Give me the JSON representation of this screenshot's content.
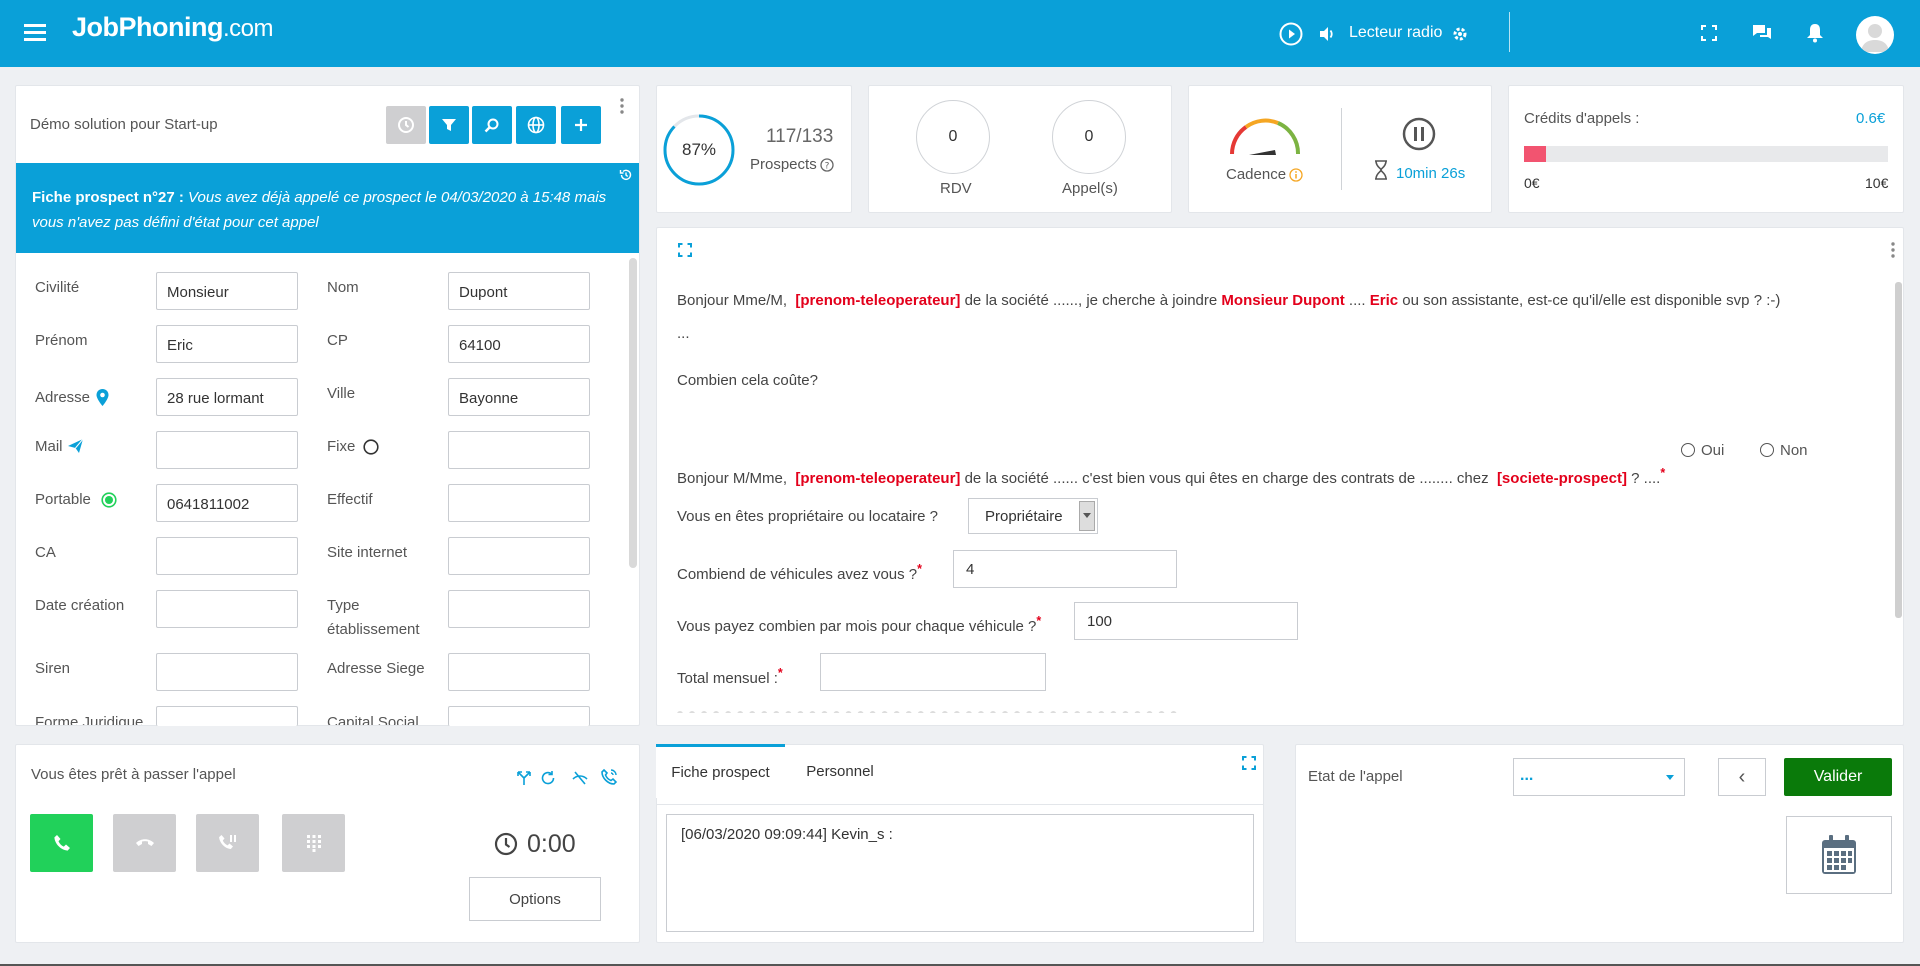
{
  "header": {
    "logo": "JobPhoning",
    "logo_suffix": ".com",
    "radio_label": "Lecteur radio"
  },
  "prospect_card": {
    "campaign": "Démo solution pour Start-up",
    "banner_title": "Fiche prospect n°27 :",
    "banner_text": "Vous avez déjà appelé ce prospect le 04/03/2020 à 15:48 mais vous n'avez pas défini d'état pour cet appel",
    "fields_left": [
      {
        "label": "Civilité",
        "value": "Monsieur"
      },
      {
        "label": "Prénom",
        "value": "Eric"
      },
      {
        "label": "Adresse",
        "value": "28 rue lormant"
      },
      {
        "label": "Mail",
        "value": ""
      },
      {
        "label": "Portable",
        "value": "0641811002"
      },
      {
        "label": "CA",
        "value": ""
      },
      {
        "label": "Date création",
        "value": ""
      },
      {
        "label": "Siren",
        "value": ""
      },
      {
        "label": "Forme Juridique",
        "value": ""
      }
    ],
    "fields_right": [
      {
        "label": "Nom",
        "value": "Dupont"
      },
      {
        "label": "CP",
        "value": "64100"
      },
      {
        "label": "Ville",
        "value": "Bayonne"
      },
      {
        "label": "Fixe",
        "value": ""
      },
      {
        "label": "Effectif",
        "value": ""
      },
      {
        "label": "Site internet",
        "value": ""
      },
      {
        "label": "Type établissement",
        "value": ""
      },
      {
        "label": "Adresse Siege",
        "value": ""
      },
      {
        "label": "Capital Social",
        "value": ""
      }
    ]
  },
  "stats": {
    "progress_pct": "87%",
    "progress_value": 0.87,
    "prospects_count": "117/133",
    "prospects_label": "Prospects",
    "rdv_value": "0",
    "rdv_label": "RDV",
    "calls_value": "0",
    "calls_label": "Appel(s)",
    "cadence_label": "Cadence",
    "timer": "10min 26s",
    "credits_label": "Crédits d'appels :",
    "credits_value": "0.6€",
    "credits_fill": 0.06,
    "credits_min": "0€",
    "credits_max": "10€"
  },
  "script": {
    "line1_pre": "Bonjour Mme/M,",
    "line1_tag": "[prenom-teleoperateur]",
    "line1_mid": "de la société ......, je cherche à joindre",
    "line1_name": "Monsieur Dupont",
    "line1_dots": "....",
    "line1_first": "Eric",
    "line1_post": "ou son assistante, est-ce qu'il/elle est disponible svp ? :-)",
    "ellipsis": "...",
    "question_cost": "Combien cela coûte?",
    "radio_yes": "Oui",
    "radio_no": "Non",
    "line2_pre": "Bonjour M/Mme,",
    "line2_tag": "[prenom-teleoperateur]",
    "line2_mid": "de la société ...... c'est bien vous qui êtes en charge des contrats de ........ chez",
    "line2_tag2": "[societe-prospect]",
    "line2_post": "? ....",
    "q_owner": "Vous en êtes propriétaire ou locataire ?",
    "q_owner_value": "Propriétaire",
    "q_vehicles": "Combiend de véhicules avez vous ?",
    "q_vehicles_value": "4",
    "q_monthly": "Vous payez combien par mois pour chaque véhicule ?",
    "q_monthly_value": "100",
    "q_total": "Total mensuel :",
    "q_total_value": ""
  },
  "call_panel": {
    "status": "Vous êtes prêt à passer l'appel",
    "timer": "0:00",
    "options_label": "Options"
  },
  "notes": {
    "tab_prospect": "Fiche prospect",
    "tab_personal": "Personnel",
    "note_text": "[06/03/2020 09:09:44] Kevin_s :"
  },
  "call_state": {
    "label": "Etat de l'appel",
    "select_value": "...",
    "back_label": "‹",
    "validate_label": "Valider"
  },
  "colors": {
    "brand": "#0aa0d8",
    "green": "#21d15a",
    "validate": "#0a7a0a",
    "red": "#e3001b"
  }
}
